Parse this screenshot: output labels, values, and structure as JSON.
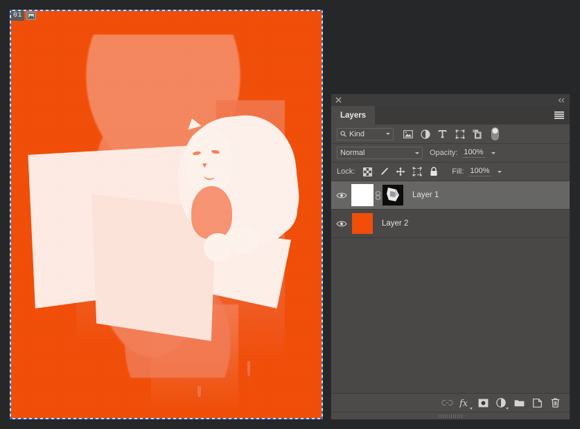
{
  "document": {
    "index_label": "01",
    "badge_icon": "image-thumbnail-icon",
    "canvas_color": "#f04e09",
    "artwork_alt": "cat-behind-laptop-duotone-illustration",
    "selection_border": "marching-ants"
  },
  "panel": {
    "title": "Layers",
    "close_icon": "close-icon",
    "collapse_icon": "collapse-double-chevron-icon",
    "menu_icon": "hamburger-menu-icon",
    "tabs": [
      {
        "label": "Layers",
        "active": true
      }
    ]
  },
  "filter": {
    "kind_label": "Kind",
    "search_icon": "search-icon",
    "chevron_icon": "chevron-down-icon",
    "icons": [
      {
        "name": "filter-pixel-layers-icon",
        "title": "Pixel layers"
      },
      {
        "name": "filter-adjustment-layers-icon",
        "title": "Adjustment layers"
      },
      {
        "name": "filter-type-layers-icon",
        "title": "Type layers"
      },
      {
        "name": "filter-shape-layers-icon",
        "title": "Shape layers"
      },
      {
        "name": "filter-smart-object-icon",
        "title": "Smart objects"
      }
    ],
    "toggle_icon": "filter-enable-toggle"
  },
  "blend": {
    "mode": "Normal",
    "opacity_label": "Opacity:",
    "opacity_value": "100%"
  },
  "lock": {
    "label": "Lock:",
    "fill_label": "Fill:",
    "fill_value": "100%",
    "icons": [
      {
        "name": "lock-transparent-pixels-icon"
      },
      {
        "name": "lock-image-pixels-icon"
      },
      {
        "name": "lock-position-icon"
      },
      {
        "name": "lock-artboard-nesting-icon"
      },
      {
        "name": "lock-all-icon"
      }
    ]
  },
  "layers": [
    {
      "name": "Layer 1",
      "visible": true,
      "selected": true,
      "thumbnail": "white",
      "linked": true,
      "has_mask": true,
      "mask_thumbnail": "artwork-mask"
    },
    {
      "name": "Layer 2",
      "visible": true,
      "selected": false,
      "thumbnail": "orange",
      "linked": false,
      "has_mask": false,
      "mask_thumbnail": ""
    }
  ],
  "bottom_toolbar": [
    {
      "name": "link-layers-button",
      "label": "Link layers",
      "disabled": true
    },
    {
      "name": "layer-style-fx-button",
      "label": "fx"
    },
    {
      "name": "add-layer-mask-button",
      "label": "Add layer mask"
    },
    {
      "name": "new-adjustment-layer-button",
      "label": "New fill or adjustment layer"
    },
    {
      "name": "new-group-button",
      "label": "New group"
    },
    {
      "name": "new-layer-button",
      "label": "New layer"
    },
    {
      "name": "delete-layer-button",
      "label": "Delete layer"
    }
  ],
  "colors": {
    "app_background": "#262729",
    "panel_background": "#4d4b49",
    "panel_header": "#3a3a3a",
    "row_selected": "#666664",
    "row_normal": "#4a4846",
    "accent_orange": "#f04e09",
    "text": "#d4d4d4"
  }
}
